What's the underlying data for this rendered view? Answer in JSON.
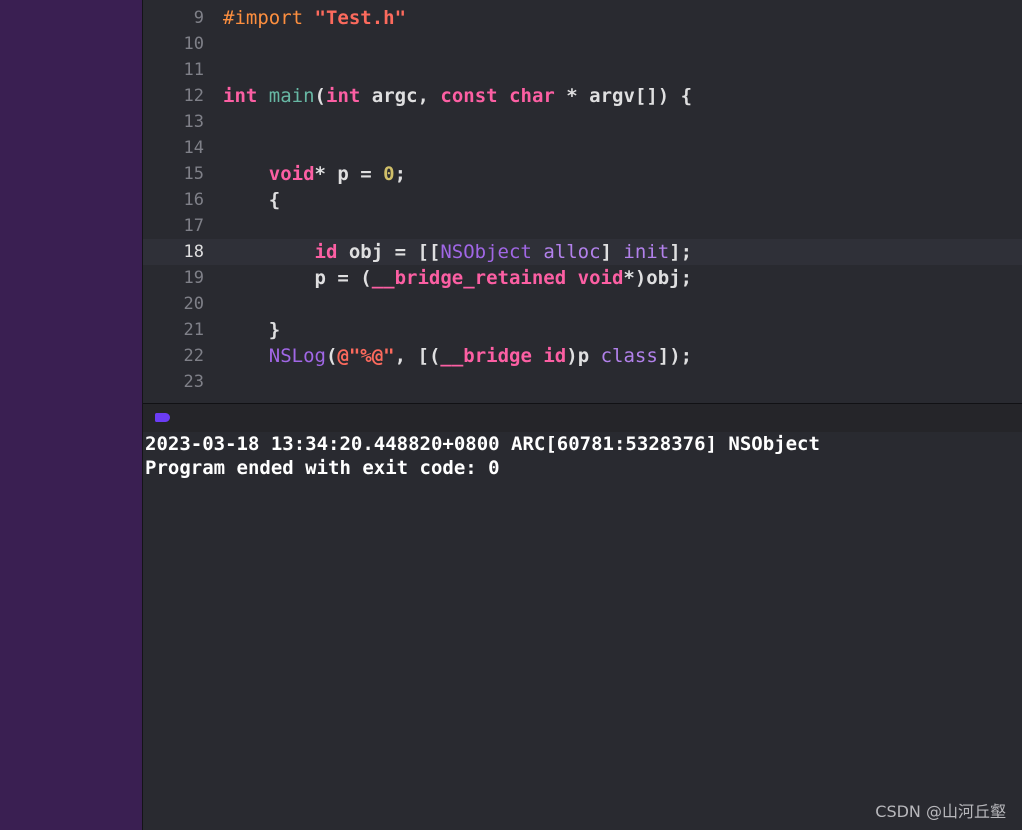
{
  "editor": {
    "lines": [
      {
        "num": "9",
        "text": "#import \"Test.h\""
      },
      {
        "num": "10",
        "text": ""
      },
      {
        "num": "11",
        "text": ""
      },
      {
        "num": "12",
        "text": "int main(int argc, const char * argv[]) {"
      },
      {
        "num": "13",
        "text": ""
      },
      {
        "num": "14",
        "text": ""
      },
      {
        "num": "15",
        "text": "    void* p = 0;"
      },
      {
        "num": "16",
        "text": "    {"
      },
      {
        "num": "17",
        "text": ""
      },
      {
        "num": "18",
        "text": "        id obj = [[NSObject alloc] init];"
      },
      {
        "num": "19",
        "text": "        p = (__bridge_retained void*)obj;"
      },
      {
        "num": "20",
        "text": ""
      },
      {
        "num": "21",
        "text": "    }"
      },
      {
        "num": "22",
        "text": "    NSLog(@\"%@\", [(__bridge id)p class]);"
      },
      {
        "num": "23",
        "text": ""
      }
    ],
    "current_line": "18"
  },
  "console": {
    "lines": [
      "2023-03-18 13:34:20.448820+0800 ARC[60781:5328376] NSObject",
      "Program ended with exit code: 0"
    ]
  },
  "watermark": "CSDN @山河丘壑",
  "colors": {
    "sidebar": "#3a1f52",
    "editor_bg": "#292a30",
    "keyword": "#fc5fa3",
    "string": "#fc6a5d",
    "preprocessor": "#fd8f3f",
    "number": "#d0bf69",
    "class": "#a167e6",
    "indicator": "#6b3cf5"
  }
}
